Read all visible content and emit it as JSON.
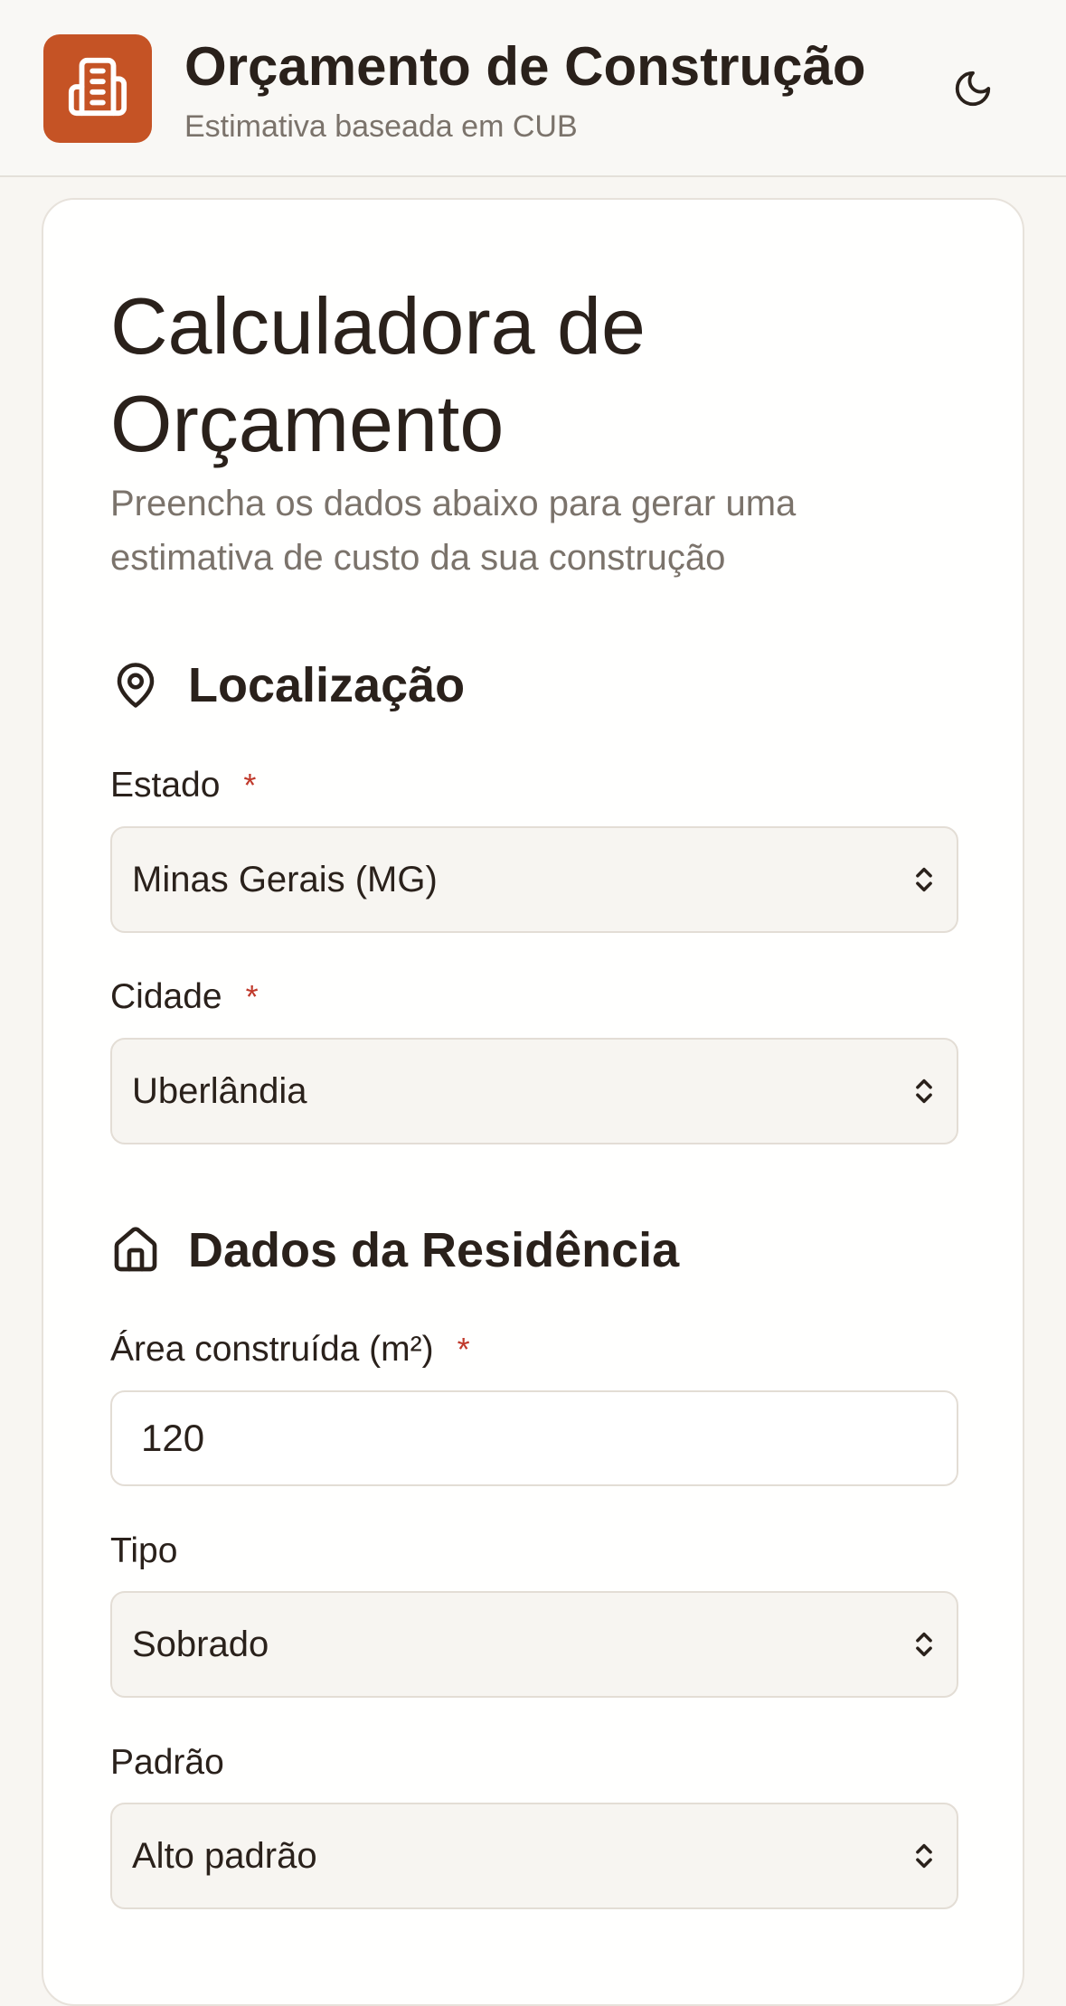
{
  "header": {
    "title": "Orçamento de Construção",
    "subtitle": "Estimativa baseada em CUB",
    "logo_icon": "building-icon",
    "theme_icon": "moon-icon",
    "brand_color": "#c55325"
  },
  "card": {
    "title": "Calculadora de Orçamento",
    "description": "Preencha os dados abaixo para gerar uma estimativa de custo da sua construção"
  },
  "location_section": {
    "title": "Localização",
    "icon": "map-pin-icon",
    "state": {
      "label": "Estado",
      "required_mark": "*",
      "value": "Minas Gerais (MG)"
    },
    "city": {
      "label": "Cidade",
      "required_mark": "*",
      "value": "Uberlândia"
    }
  },
  "residence_section": {
    "title": "Dados da Residência",
    "icon": "home-icon",
    "area": {
      "label": "Área construída (m²)",
      "required_mark": "*",
      "value": "120"
    },
    "type": {
      "label": "Tipo",
      "value": "Sobrado"
    },
    "standard": {
      "label": "Padrão",
      "value": "Alto padrão"
    }
  },
  "colors": {
    "required": "#c0392b",
    "muted_text": "#7b736b",
    "text": "#2a211b"
  }
}
